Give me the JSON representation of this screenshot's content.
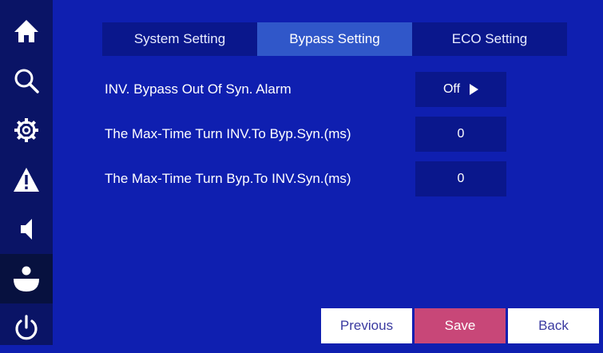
{
  "sidebar": {
    "items": [
      {
        "icon": "home-icon"
      },
      {
        "icon": "search-icon"
      },
      {
        "icon": "gear-icon"
      },
      {
        "icon": "warning-icon"
      },
      {
        "icon": "speaker-icon"
      },
      {
        "icon": "user-icon",
        "active": true
      },
      {
        "icon": "power-icon"
      }
    ]
  },
  "tabs": [
    {
      "label": "System Setting"
    },
    {
      "label": "Bypass Setting",
      "active": true
    },
    {
      "label": "ECO Setting"
    }
  ],
  "settings": [
    {
      "label": "INV. Bypass Out Of Syn. Alarm",
      "value": "Off"
    },
    {
      "label": "The Max-Time Turn INV.To Byp.Syn.(ms)",
      "value": "0"
    },
    {
      "label": "The Max-Time Turn Byp.To INV.Syn.(ms)",
      "value": "0"
    }
  ],
  "footer": {
    "previous_label": "Previous",
    "save_label": "Save",
    "back_label": "Back"
  },
  "colors": {
    "background": "#0f1fb0",
    "sidebar": "#0a1466",
    "active_tab": "#3057c9",
    "save_button": "#c84778"
  }
}
